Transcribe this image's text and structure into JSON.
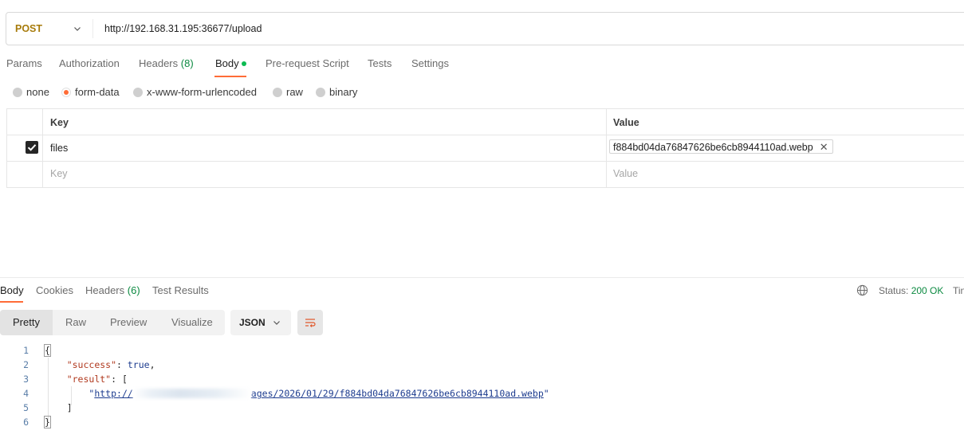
{
  "request": {
    "method": "POST",
    "url": "http://192.168.31.195:36677/upload",
    "tabs": [
      {
        "label": "Params"
      },
      {
        "label": "Authorization"
      },
      {
        "label": "Headers",
        "count": "(8)"
      },
      {
        "label": "Body"
      },
      {
        "label": "Pre-request Script"
      },
      {
        "label": "Tests"
      },
      {
        "label": "Settings"
      }
    ],
    "active_tab": "Body",
    "body_types": [
      "none",
      "form-data",
      "x-www-form-urlencoded",
      "raw",
      "binary"
    ],
    "selected_body_type": "form-data",
    "table": {
      "headers": {
        "key": "Key",
        "value": "Value"
      },
      "rows": [
        {
          "checked": true,
          "key": "files",
          "value": "f884bd04da76847626be6cb8944110ad.webp"
        }
      ],
      "new_row": {
        "key_placeholder": "Key",
        "value_placeholder": "Value"
      }
    }
  },
  "response": {
    "tabs": [
      {
        "label": "Body"
      },
      {
        "label": "Cookies"
      },
      {
        "label": "Headers",
        "count": "(6)"
      },
      {
        "label": "Test Results"
      }
    ],
    "status_label": "Status:",
    "status_value": "200 OK",
    "time_label_partial": "Tin",
    "view_modes": [
      "Pretty",
      "Raw",
      "Preview",
      "Visualize"
    ],
    "active_view": "Pretty",
    "format": "JSON",
    "code": {
      "line_numbers": [
        "1",
        "2",
        "3",
        "4",
        "5",
        "6"
      ],
      "open_brace": "{",
      "success_key": "\"success\"",
      "success_value": "true",
      "result_key": "\"result\"",
      "open_bracket": "[",
      "url_prefix": "http://",
      "url_suffix": "ages/2026/01/29/f884bd04da76847626be6cb8944110ad.webp",
      "close_bracket": "]",
      "close_brace": "}"
    }
  },
  "colors": {
    "accent": "#ff6c37",
    "method": "#a77b0b",
    "success_green": "#0c8a41"
  }
}
